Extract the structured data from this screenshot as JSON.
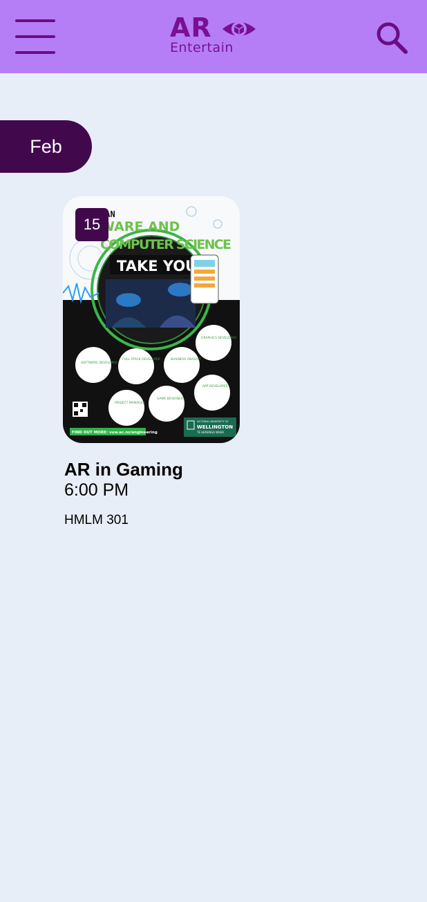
{
  "header": {
    "logo": {
      "main": "AR",
      "sub": "Entertain"
    },
    "menu_icon": "hamburger-menu-icon",
    "search_icon": "search-icon",
    "background": "#b57ef7",
    "accent": "#7a0f92"
  },
  "month": {
    "label": "Feb",
    "color": "#42084c"
  },
  "events": [
    {
      "day": "15",
      "title": "AR in Gaming",
      "time": "6:00 PM",
      "location": "HMLM 301",
      "poster": {
        "headline_top": "CAN",
        "headline_line1": "WARE AND",
        "headline_line2": "COMPUTER SCIENCE",
        "headline_line3": "TAKE YOU?",
        "roles": [
          "SOFTWARE DEVELOPER",
          "FULL STACK DEVELOPER",
          "BUSINESS ANALYST",
          "GRAPHICS DEVELOPER",
          "APP DEVELOPER",
          "GAME DESIGNER",
          "PROJECT MANAGER"
        ],
        "footer_link": "FIND OUT MORE: vuw.ac.nz/engineering",
        "university_top": "VICTORIA UNIVERSITY OF",
        "university": "WELLINGTON",
        "university_sub": "TE HERENGA WAKA"
      }
    }
  ],
  "page_background": "#e8eef8"
}
